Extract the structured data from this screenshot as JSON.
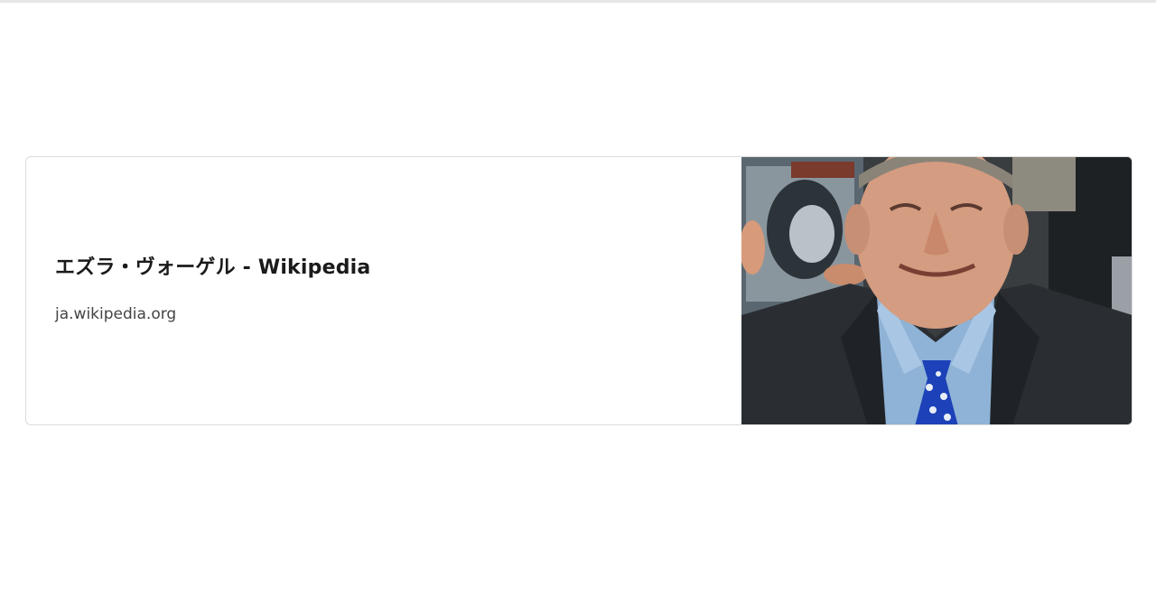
{
  "link_card": {
    "title": "エズラ・ヴォーゲル - Wikipedia",
    "domain": "ja.wikipedia.org",
    "thumbnail": {
      "subject": "portrait of an elderly man in a dark suit and blue tie"
    }
  }
}
